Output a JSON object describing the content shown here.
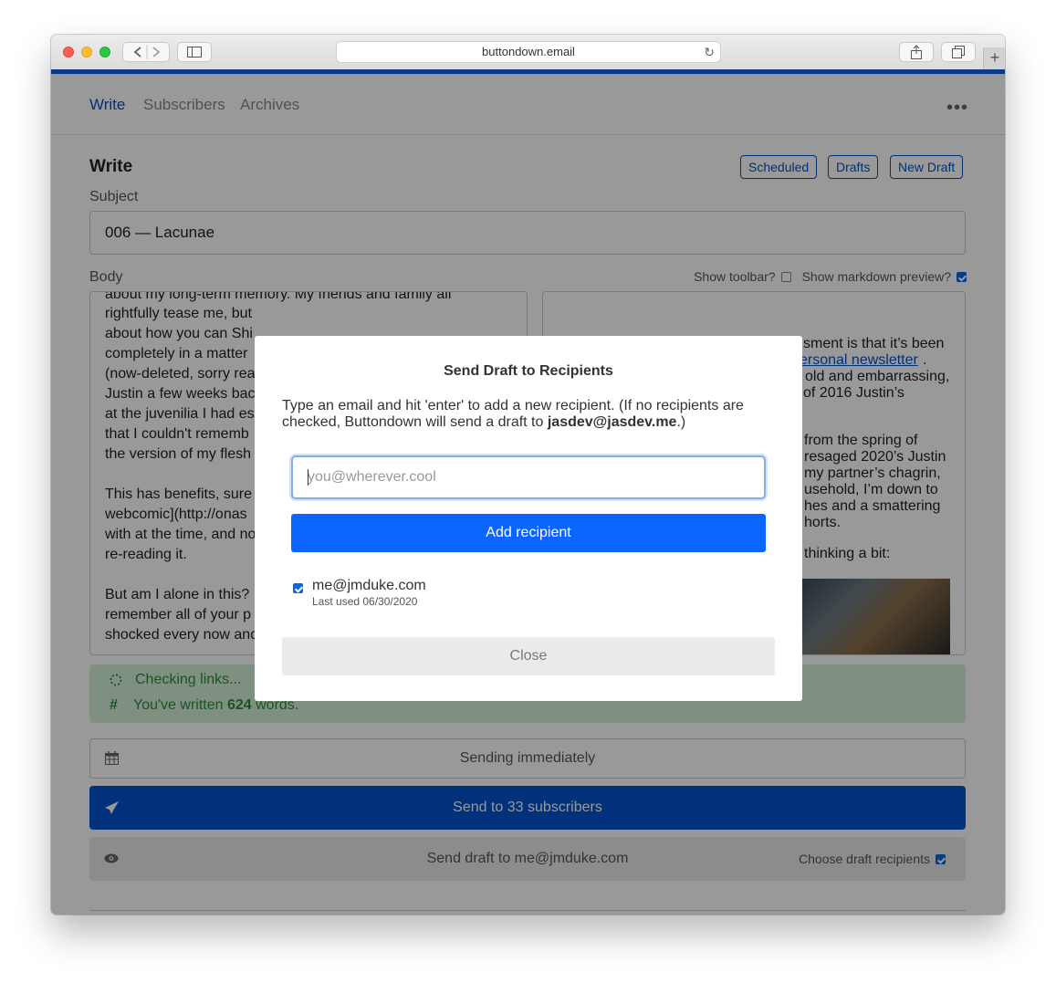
{
  "browser": {
    "url": "buttondown.email"
  },
  "nav": {
    "write": "Write",
    "subscribers": "Subscribers",
    "archives": "Archives",
    "more": "•••"
  },
  "header": {
    "title": "Write",
    "scheduled": "Scheduled",
    "drafts": "Drafts",
    "new_draft": "New Draft"
  },
  "subject": {
    "label": "Subject",
    "value": "006 — Lacunae"
  },
  "body": {
    "label": "Body",
    "show_toolbar": "Show toolbar?",
    "show_markdown_preview": "Show markdown preview?",
    "editor_lines": [
      "about my long-term memory. My friends and family all",
      "rightfully tease me, but",
      "about how you can Shi",
      "completely in a matter",
      "(now-deleted, sorry rea",
      "Justin a few weeks bac",
      "at the juvenilia I had es",
      "that I couldn't rememb",
      "the version of my flesh",
      "",
      "This has benefits, sure",
      "webcomic](http://onas",
      "with at the time, and no",
      "re-reading it.",
      "",
      "But am I alone in this?",
      "remember all of your p",
      "shocked every now and"
    ],
    "preview_lines": [
      "sment is that it’s been",
      "ersonal newsletter",
      "old and embarrassing,",
      "of 2016 Justin’s",
      "from the spring of",
      "resaged 2020’s Justin",
      "my partner’s chagrin,",
      "usehold, I’m down to",
      "hes and a smattering",
      "horts.",
      "thinking a bit:"
    ]
  },
  "status": {
    "checking": "Checking links...",
    "words_prefix": "You've written ",
    "word_count": "624",
    "words_suffix": " words."
  },
  "actions": {
    "sending_time": "Sending immediately",
    "send": "Send to 33 subscribers",
    "send_draft": "Send draft to me@jmduke.com",
    "choose_recipients": "Choose draft recipients"
  },
  "modal": {
    "title": "Send Draft to Recipients",
    "description_prefix": "Type an email and hit 'enter' to add a new recipient. (If no recipients are checked, Buttondown will send a draft to ",
    "default_email": "jasdev@jasdev.me",
    "description_suffix": ".)",
    "input_placeholder": "you@wherever.cool",
    "add_button": "Add recipient",
    "recipients": [
      {
        "email": "me@jmduke.com",
        "last_used": "Last used 06/30/2020",
        "checked": true
      }
    ],
    "close_button": "Close"
  },
  "colors": {
    "brand_blue": "#0052cc",
    "button_blue": "#0a66ff",
    "success_bg": "#d4efd9",
    "success_text": "#2f8a3b"
  }
}
